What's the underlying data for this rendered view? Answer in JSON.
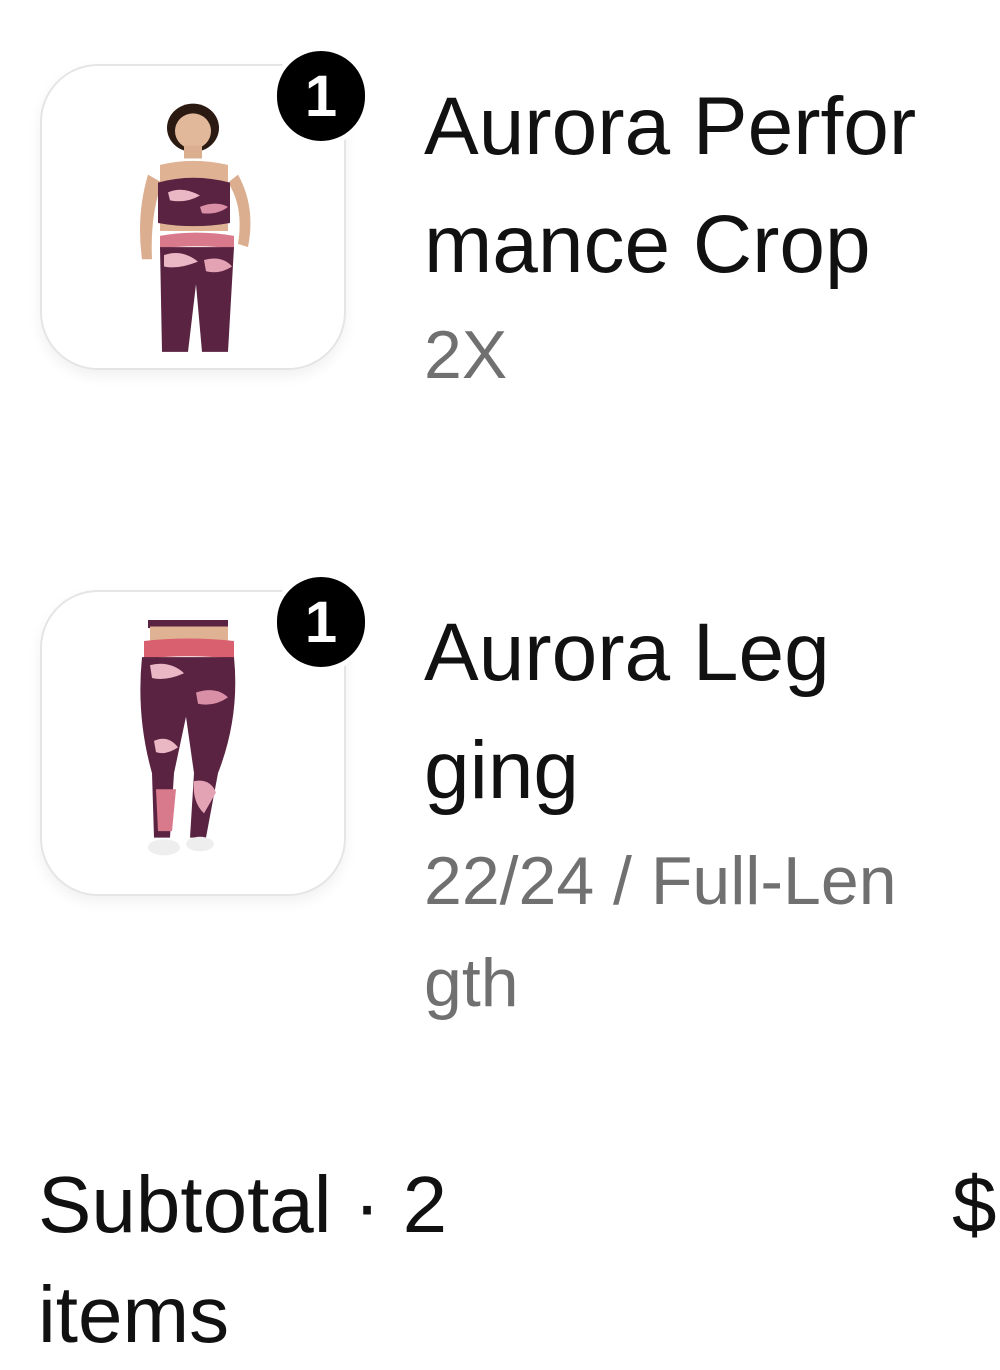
{
  "cart": {
    "items": [
      {
        "quantity": "1",
        "title": "Aurora Performance Crop",
        "variant": "2X"
      },
      {
        "quantity": "1",
        "title": "Aurora Legging",
        "variant": "22/24 / Full-Length"
      }
    ]
  },
  "summary": {
    "subtotal_label": "Subtotal · 2 items",
    "subtotal_value": "$"
  },
  "colors": {
    "badge": "#000000",
    "title": "#111111",
    "variant": "#707070",
    "fabric": "#5a2342",
    "fabric_light": "#e9b8c4"
  }
}
